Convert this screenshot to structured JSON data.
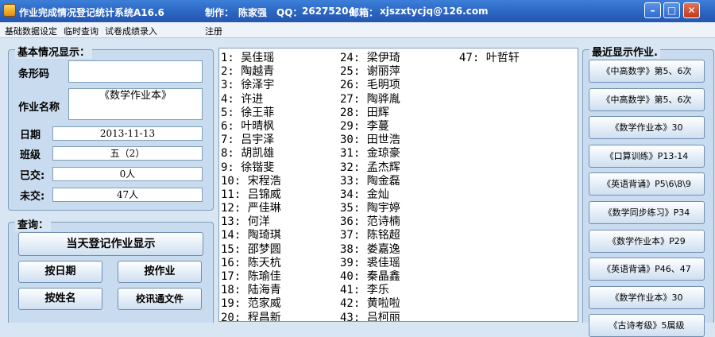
{
  "window": {
    "title": "作业完成情况登记统计系统A16.6",
    "author_label": "制作：",
    "author_name": "陈家强",
    "qq_label": "QQ：",
    "qq_number": "26275204",
    "email_label": "邮箱：",
    "email": "xjszxtycjq@126.com",
    "minimize": "–",
    "maximize": "□",
    "close": "✕"
  },
  "menu": [
    "基础数据设定",
    "临时查询",
    "试卷成绩录入",
    "注册"
  ],
  "basic_info": {
    "title": "基本情况显示：",
    "barcode_label": "条形码",
    "barcode_value": "",
    "homework_label": "作业名称",
    "homework_value": "《数学作业本》",
    "date_label": "日期",
    "date_value": "2013-11-13",
    "class_label": "班级",
    "class_value": "五（2）",
    "submitted_label": "已交:",
    "submitted_value": "0人",
    "unsubmitted_label": "未交:",
    "unsubmitted_value": "47人"
  },
  "query": {
    "title": "查询：",
    "today_button": "当天登记作业显示",
    "by_date": "按日期",
    "by_homework": "按作业",
    "by_name": "按姓名",
    "xuntong_file": "校讯通文件"
  },
  "roster": {
    "col1": [
      "1: 吴佳瑶",
      "2: 陶越青",
      "3: 徐泽宇",
      "4: 许进",
      "5: 徐王菲",
      "6: 叶晴枫",
      "7: 吕宇泽",
      "8: 胡凯雄",
      "9: 徐锴斐",
      "10: 宋程浩",
      "11: 吕锦威",
      "12: 严佳琳",
      "13: 何洋",
      "14: 陶琦琪",
      "15: 邵梦圆",
      "16: 陈天杭",
      "17: 陈瑜佳",
      "18: 陆海青",
      "19: 范家威",
      "20: 程昌新"
    ],
    "col2": [
      "24: 梁伊琦",
      "25: 谢丽萍",
      "26: 毛明项",
      "27: 陶骅胤",
      "28: 田辉",
      "29: 李蔓",
      "30: 田世浩",
      "31: 金琼豪",
      "32: 孟杰辉",
      "33: 陶金磊",
      "34: 金灿",
      "35: 陶宇婷",
      "36: 范诗楠",
      "37: 陈铭超",
      "38: 娄嘉逸",
      "39: 裘佳瑶",
      "40: 秦晶鑫",
      "41: 李乐",
      "42: 黄啦啦",
      "43: 吕柯丽"
    ],
    "col3": [
      "47: 叶哲轩"
    ]
  },
  "recent": {
    "title": "最近显示作业.",
    "items": [
      "《中高数学》第5、6次",
      "《中高数学》第5、6次",
      "《数学作业本》30",
      "《口算训练》P13-14",
      "《英语背诵》P5\\6\\8\\9",
      "《数学同步练习》P34",
      "《数学作业本》P29",
      "《英语背诵》P46、47",
      "《数学作业本》30",
      "《古诗考级》5属级"
    ]
  }
}
